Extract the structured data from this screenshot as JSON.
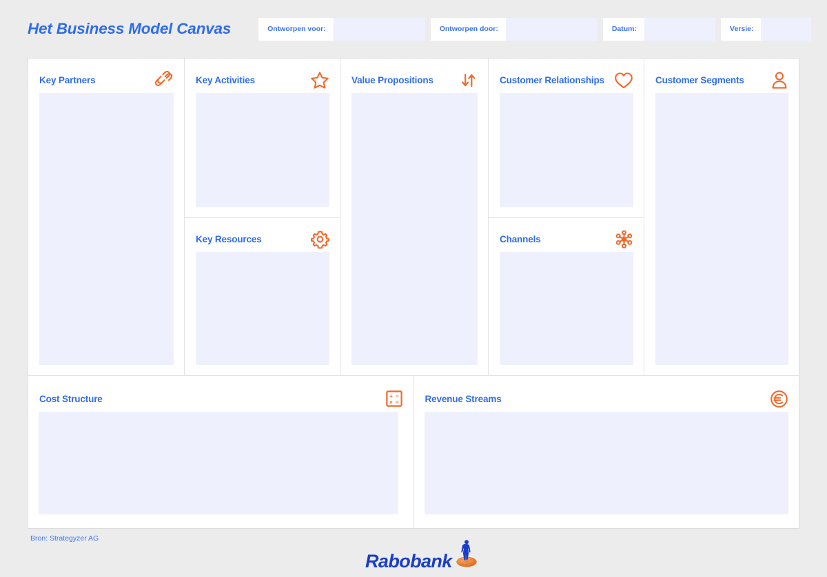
{
  "header": {
    "title": "Het Business Model Canvas",
    "fields": [
      {
        "label": "Ontworpen voor:",
        "value": "",
        "placeholder": ""
      },
      {
        "label": "Ontworpen door:",
        "value": "",
        "placeholder": ""
      },
      {
        "label": "Datum:",
        "value": "",
        "placeholder": ""
      },
      {
        "label": "Versie:",
        "value": "",
        "placeholder": ""
      }
    ]
  },
  "blocks": {
    "key_partners": {
      "title": "Key Partners",
      "icon": "chain-link-icon",
      "content": ""
    },
    "key_activities": {
      "title": "Key Activities",
      "icon": "star-icon",
      "content": ""
    },
    "key_resources": {
      "title": "Key Resources",
      "icon": "gear-icon",
      "content": ""
    },
    "value_propositions": {
      "title": "Value Propositions",
      "icon": "up-down-arrows-icon",
      "content": ""
    },
    "customer_relationships": {
      "title": "Customer Relationships",
      "icon": "heart-icon",
      "content": ""
    },
    "channels": {
      "title": "Channels",
      "icon": "network-hub-icon",
      "content": ""
    },
    "customer_segments": {
      "title": "Customer Segments",
      "icon": "person-icon",
      "content": ""
    },
    "cost_structure": {
      "title": "Cost Structure",
      "icon": "calculator-icon",
      "content": ""
    },
    "revenue_streams": {
      "title": "Revenue Streams",
      "icon": "euro-circle-icon",
      "content": ""
    }
  },
  "footer": {
    "source": "Bron: Strategyzer AG",
    "logo_text": "Rabobank",
    "logo_mark": "rabobank-figure-globe-icon"
  },
  "colors": {
    "page_background": "#ececec",
    "card_background": "#ffffff",
    "accent_blue": "#2f6ced",
    "accent_orange": "#f2682a",
    "field_fill": "#eef1fd",
    "divider": "#e2e2e2",
    "logo_blue": "#1a3ec8",
    "logo_orange": "#ef7c2a"
  }
}
